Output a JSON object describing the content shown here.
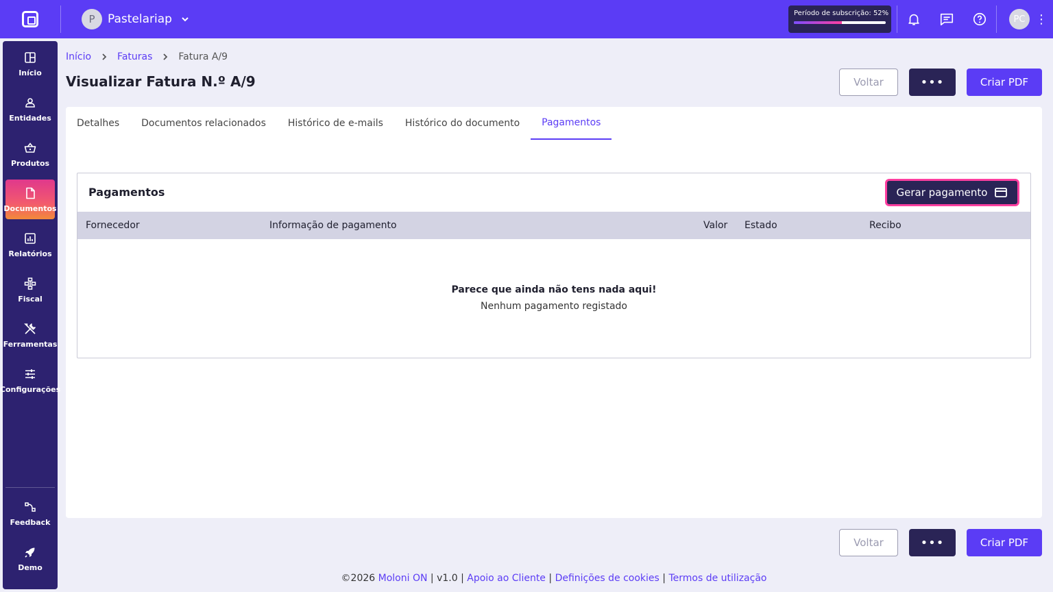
{
  "topbar": {
    "company_initial": "P",
    "company_name": "Pastelariap",
    "subscription_label": "Período de subscrição: 52%",
    "subscription_progress": 52,
    "user_initials": "PC"
  },
  "sidebar": {
    "items": [
      {
        "label": "Início",
        "icon": "dashboard-icon"
      },
      {
        "label": "Entidades",
        "icon": "user-icon"
      },
      {
        "label": "Produtos",
        "icon": "basket-icon"
      },
      {
        "label": "Documentos",
        "icon": "document-icon",
        "active": true
      },
      {
        "label": "Relatórios",
        "icon": "chart-icon"
      },
      {
        "label": "Fiscal",
        "icon": "fiscal-icon"
      },
      {
        "label": "Ferramentas",
        "icon": "tools-icon"
      },
      {
        "label": "Configurações",
        "icon": "sliders-icon"
      },
      {
        "label": "Feedback",
        "icon": "feedback-icon"
      },
      {
        "label": "Demo",
        "icon": "rocket-icon"
      }
    ]
  },
  "breadcrumb": {
    "home": "Início",
    "section": "Faturas",
    "current": "Fatura A/9"
  },
  "page": {
    "title": "Visualizar Fatura N.º A/9",
    "back_label": "Voltar",
    "more_label": "•••",
    "pdf_label": "Criar PDF"
  },
  "tabs": [
    {
      "label": "Detalhes"
    },
    {
      "label": "Documentos relacionados"
    },
    {
      "label": "Histórico de e-mails"
    },
    {
      "label": "Histórico do documento"
    },
    {
      "label": "Pagamentos",
      "active": true
    }
  ],
  "payments": {
    "title": "Pagamentos",
    "generate_label": "Gerar pagamento",
    "columns": [
      "Fornecedor",
      "Informação de pagamento",
      "Valor",
      "Estado",
      "Recibo"
    ],
    "empty_title": "Parece que ainda não tens nada aqui!",
    "empty_subtitle": "Nenhum pagamento registado"
  },
  "footer": {
    "copyright": "©2026",
    "brand": "Moloni ON",
    "sep1": "|",
    "version": "v1.0",
    "sep2": "|",
    "support": "Apoio ao Cliente",
    "sep3": "|",
    "cookies": "Definições de cookies",
    "sep4": "|",
    "terms": "Termos de utilização"
  },
  "colors": {
    "primary": "#5b3cf5",
    "dark": "#2a2456",
    "sidebar": "#2d2270",
    "highlight": "#ff3fa0"
  }
}
